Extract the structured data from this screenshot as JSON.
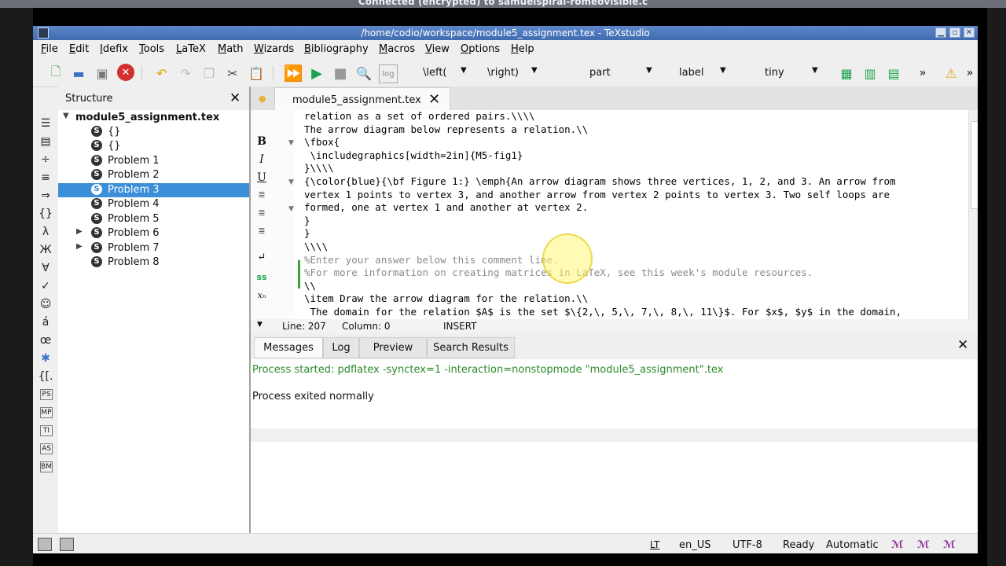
{
  "connection_banner": "Connected (encrypted) to samuelspiral-romeovisible.c",
  "window": {
    "title": "/home/codio/workspace/module5_assignment.tex - TeXstudio",
    "buttons": [
      "minimize",
      "maximize",
      "close"
    ]
  },
  "menu": [
    "File",
    "Edit",
    "Idefix",
    "Tools",
    "LaTeX",
    "Math",
    "Wizards",
    "Bibliography",
    "Macros",
    "View",
    "Options",
    "Help"
  ],
  "toolbar": {
    "left_combo": "\\left(",
    "right_combo": "\\right)",
    "part_combo": "part",
    "label_combo": "label",
    "size_combo": "tiny",
    "overflow": "»"
  },
  "structure": {
    "title": "Structure",
    "root": "module5_assignment.tex",
    "items": [
      {
        "label": "{}",
        "expandable": false,
        "selected": false
      },
      {
        "label": "{}",
        "expandable": false,
        "selected": false
      },
      {
        "label": "Problem 1",
        "expandable": false,
        "selected": false
      },
      {
        "label": "Problem 2",
        "expandable": false,
        "selected": false
      },
      {
        "label": "Problem 3",
        "expandable": false,
        "selected": true
      },
      {
        "label": "Problem 4",
        "expandable": false,
        "selected": false
      },
      {
        "label": "Problem 5",
        "expandable": false,
        "selected": false
      },
      {
        "label": "Problem 6",
        "expandable": true,
        "selected": false
      },
      {
        "label": "Problem 7",
        "expandable": true,
        "selected": false
      },
      {
        "label": "Problem 8",
        "expandable": false,
        "selected": false
      }
    ]
  },
  "editor": {
    "tab_label": "module5_assignment.tex",
    "lines": [
      {
        "text": "relation as a set of ordered pairs.\\\\\\\\",
        "kind": "plain"
      },
      {
        "text": "The arrow diagram below represents a relation.\\\\",
        "kind": "plain"
      },
      {
        "text": "\\fbox{",
        "kind": "blue"
      },
      {
        "text": " \\includegraphics[width=2in]{M5-fig1}",
        "kind": "blue"
      },
      {
        "text": "}\\\\\\\\",
        "kind": "plain"
      },
      {
        "text": "{\\color{blue}{\\bf Figure 1:} \\emph{An arrow diagram shows three vertices, 1, 2, and 3. An arrow from",
        "kind": "plain"
      },
      {
        "text": "vertex 1 points to vertex 3, and another arrow from vertex 2 points to vertex 3. Two self loops are",
        "kind": "plain"
      },
      {
        "text": "formed, one at vertex 1 and another at vertex 2.",
        "kind": "plain"
      },
      {
        "text": "}",
        "kind": "plain"
      },
      {
        "text": "}",
        "kind": "plain"
      },
      {
        "text": "\\\\\\\\",
        "kind": "plain"
      },
      {
        "text": "%Enter your answer below this comment line.",
        "kind": "comment"
      },
      {
        "text": "%For more information on creating matrices in LaTeX, see this week's module resources.",
        "kind": "comment"
      },
      {
        "text": "\\\\",
        "kind": "plain"
      },
      {
        "text": "\\item Draw the arrow diagram for the relation.\\\\",
        "kind": "plain"
      },
      {
        "text": " The domain for the relation $A$ is the set $\\{2,\\, 5,\\, 7,\\, 8,\\, 11\\}$. For $x$, $y$ in the domain,",
        "kind": "plain"
      }
    ],
    "status": {
      "line": "Line: 207",
      "column": "Column: 0",
      "mode": "INSERT"
    }
  },
  "messages": {
    "tabs": [
      "Messages",
      "Log",
      "Preview",
      "Search Results"
    ],
    "active_tab": "Messages",
    "process_started": "Process started: pdflatex -synctex=1 -interaction=nonstopmode \"module5_assignment\".tex",
    "process_exited": "Process exited normally"
  },
  "statusbar": {
    "language": "en_US",
    "encoding": "UTF-8",
    "state": "Ready",
    "mode": "Automatic"
  },
  "colors": {
    "selection": "#3a8fd8",
    "titlebar": "#4a76bd",
    "success_text": "#2b8a2b"
  }
}
